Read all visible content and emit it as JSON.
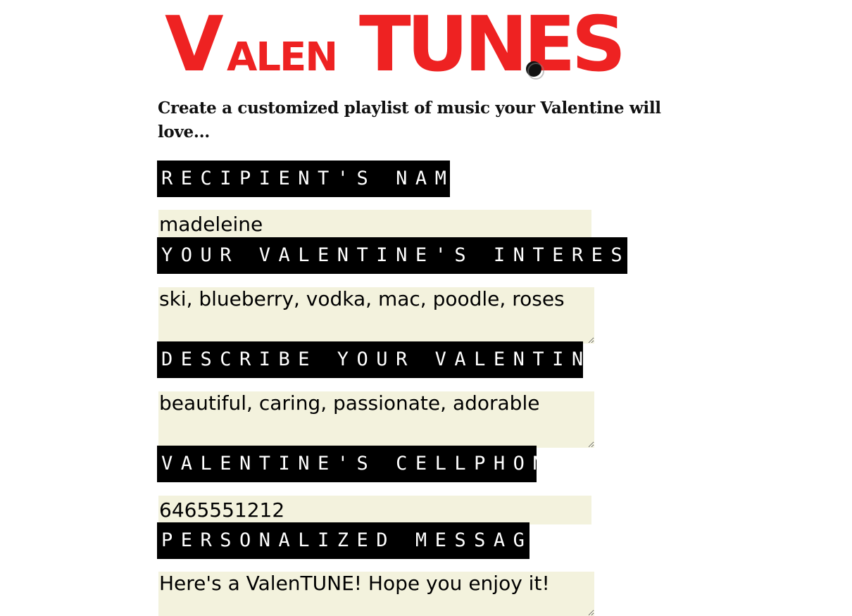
{
  "brand": {
    "logo_text": "ValenTUNES",
    "logo_color": "#ee2222"
  },
  "tagline": "Create a customized playlist of music your Valentine will love...",
  "form": {
    "recipient_label": "Recipient's Name:",
    "recipient_value": "madeleine",
    "interests_label": "Your Valentine's Interests:",
    "interests_value": "ski, blueberry, vodka, mac, poodle, roses",
    "describe_label": "Describe Your Valentine:",
    "describe_value": "beautiful, caring, passionate, adorable",
    "cellphone_label": "Valentine's Cellphone:",
    "cellphone_value": "6465551212",
    "message_label": "Personalized Message:",
    "message_value": "Here's a ValenTUNE! Hope you enjoy it!"
  },
  "colors": {
    "accent": "#ee2222",
    "label_bg": "#000000",
    "field_bg": "#f3f2dd"
  }
}
